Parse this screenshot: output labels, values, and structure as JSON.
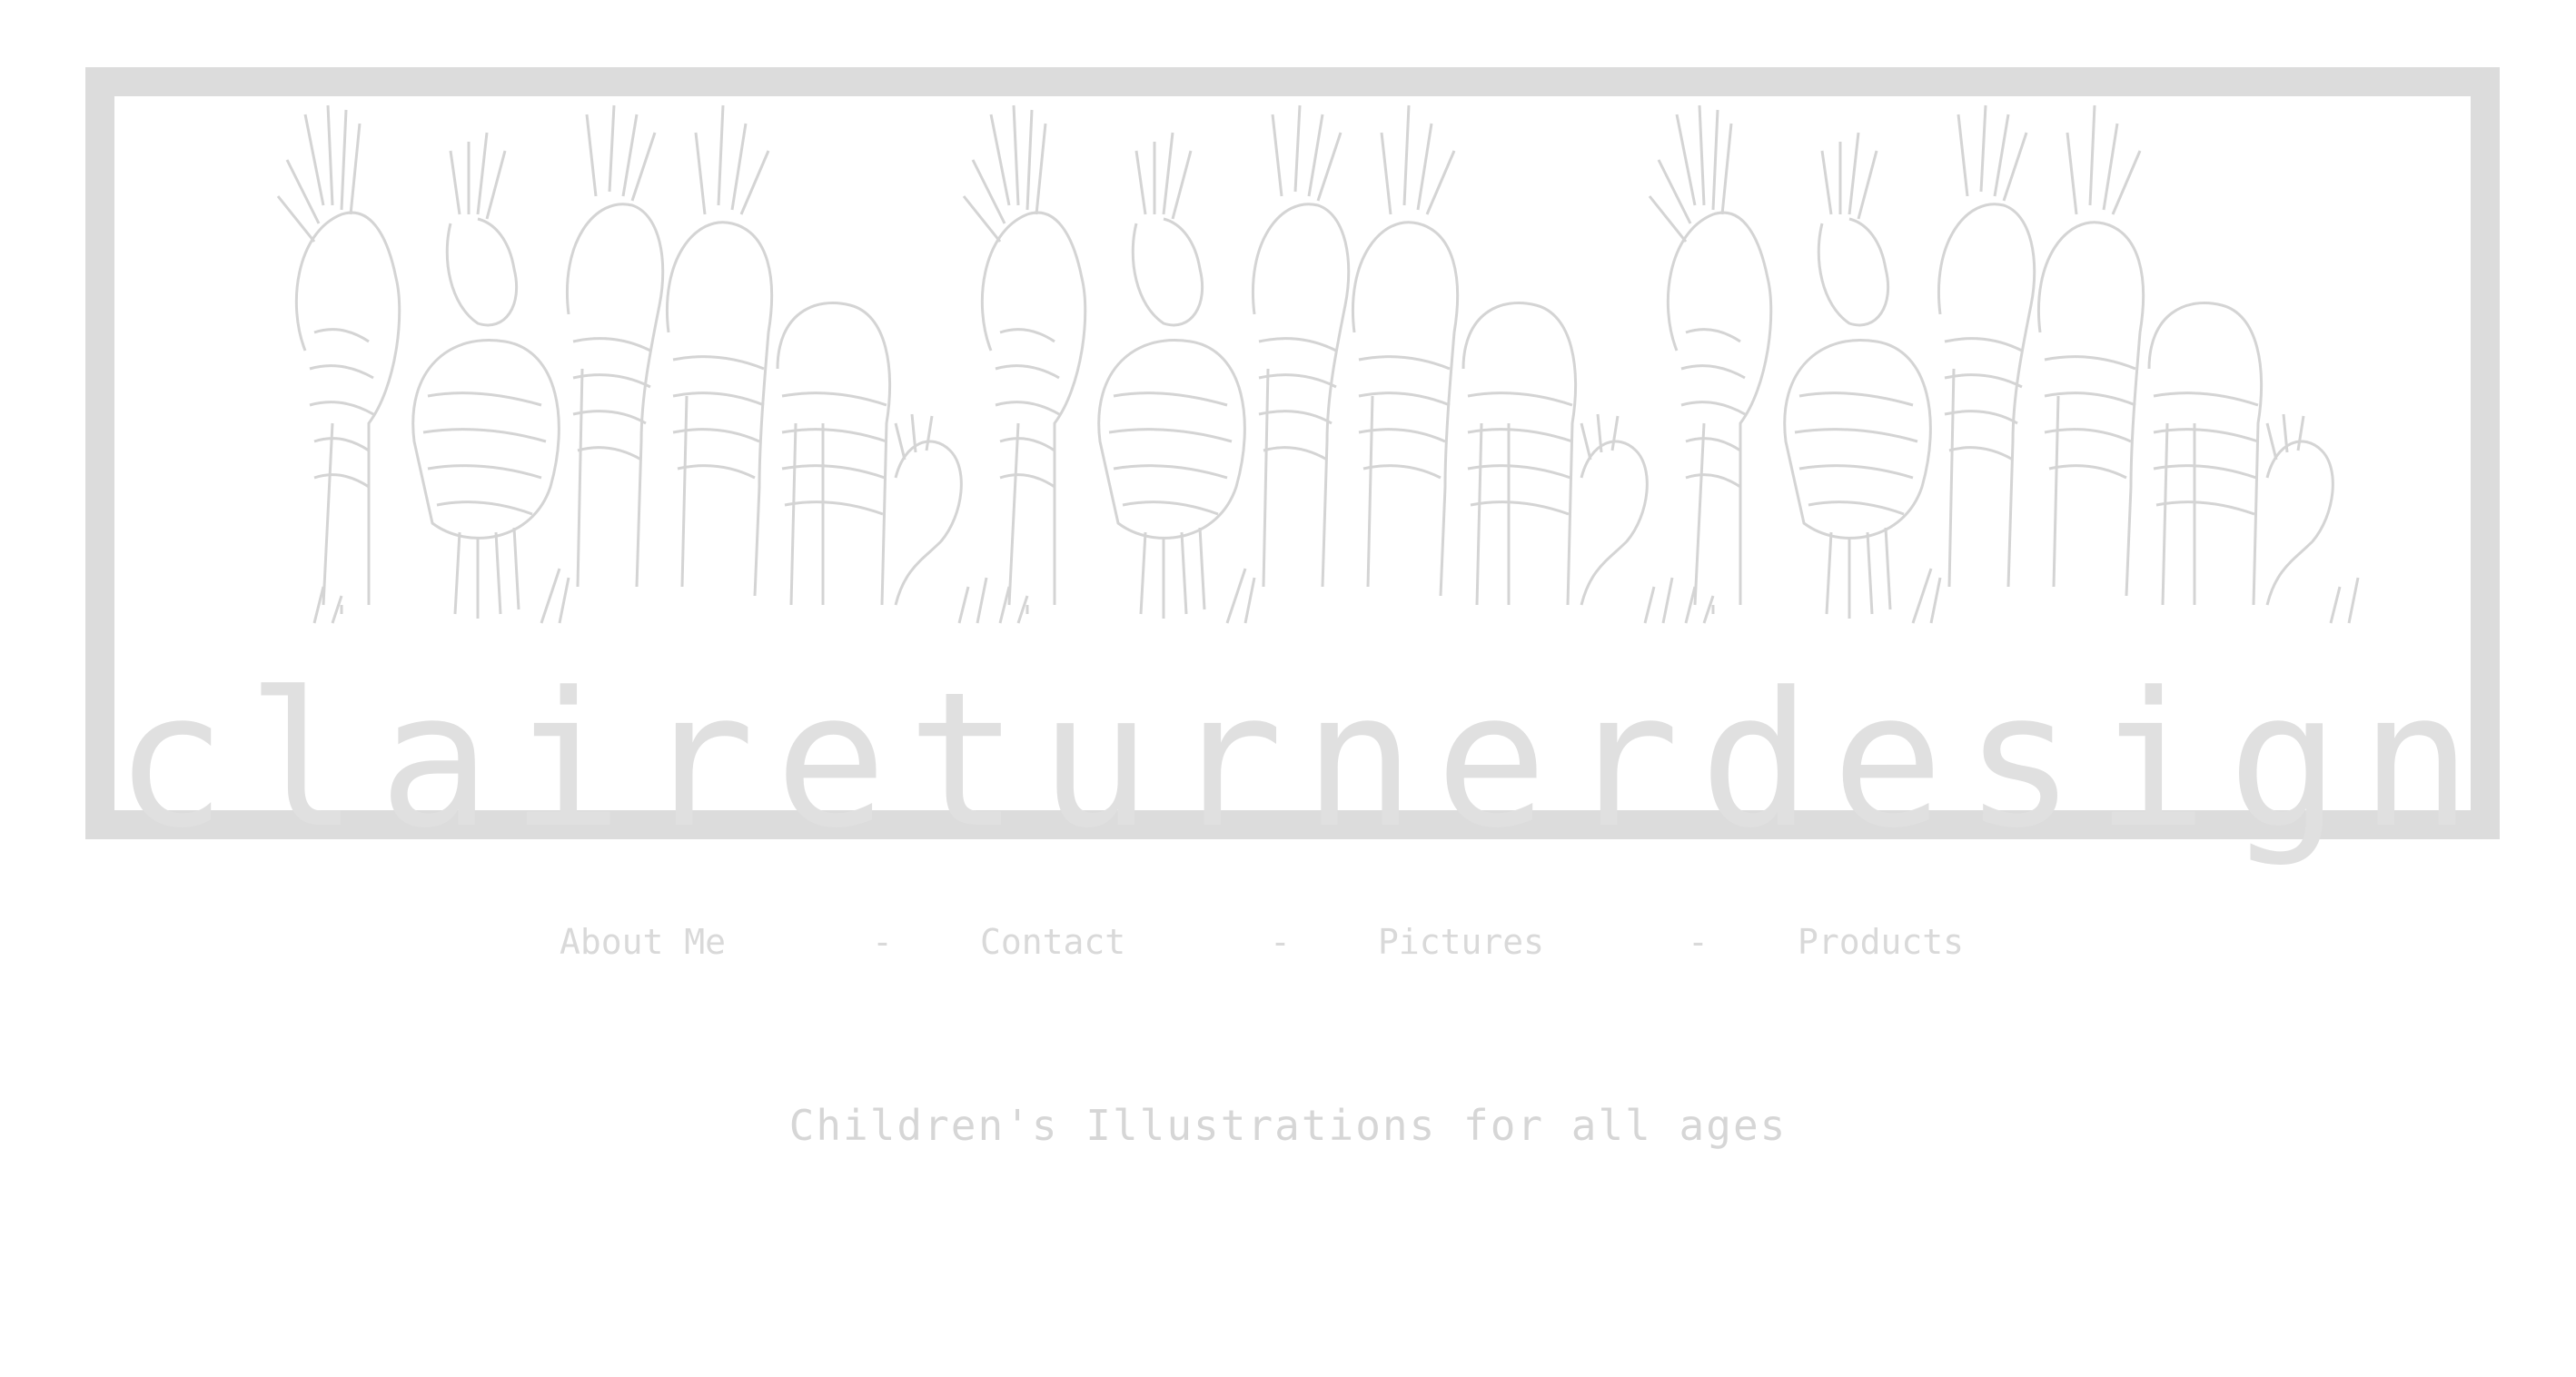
{
  "header": {
    "brand_name": "claireturnerdesign"
  },
  "nav": {
    "items": [
      {
        "label": "About Me"
      },
      {
        "label": "Contact"
      },
      {
        "label": "Pictures"
      },
      {
        "label": "Products"
      }
    ],
    "separator": "-"
  },
  "tagline": "Children's Illustrations for all ages",
  "colors": {
    "frame": "#dcdcdc",
    "text": "#d9d9d9",
    "background": "#ffffff"
  },
  "icons": {
    "banner_art": "zebra-herd-illustration"
  }
}
